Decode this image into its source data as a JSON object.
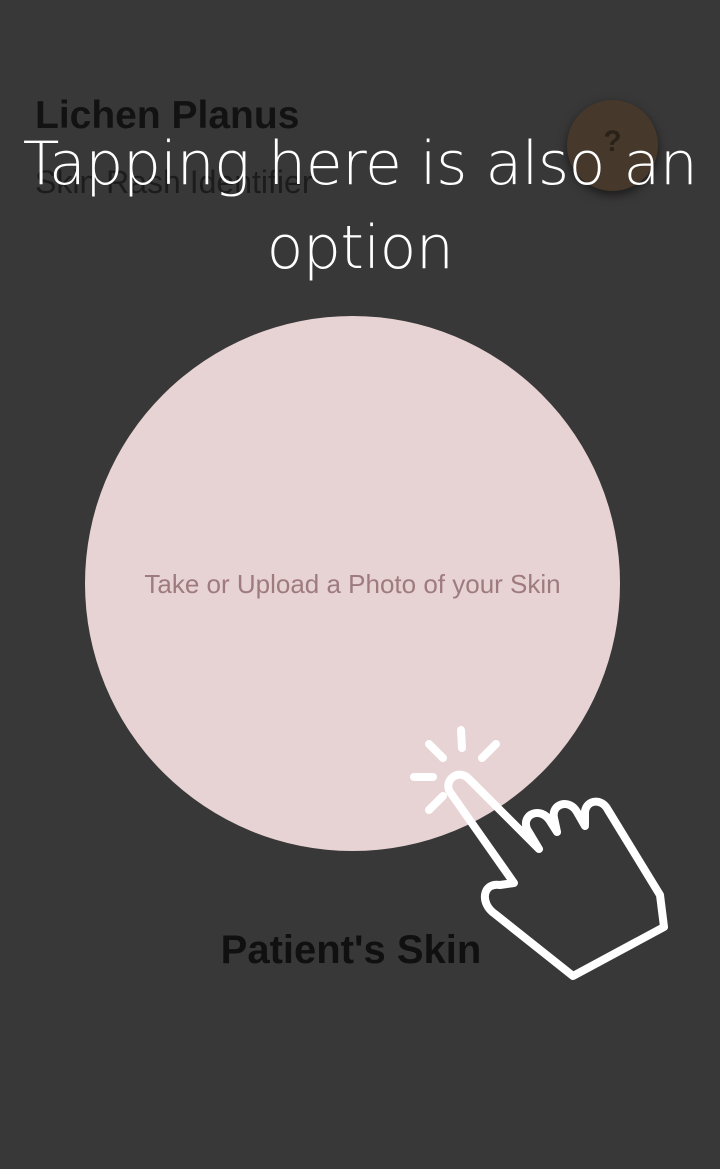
{
  "header": {
    "title": "Lichen Planus",
    "subtitle": "Skin Rash Identifier",
    "help_icon": "question-icon",
    "help_glyph": "?"
  },
  "tutorial": {
    "hint": "Tapping here is also an option",
    "gesture_icon": "tap-hand-icon"
  },
  "upload": {
    "label": "Take or Upload a Photo of your Skin"
  },
  "section": {
    "title": "Patient's Skin"
  },
  "colors": {
    "overlay": "#393838",
    "circle": "#e8d3d4",
    "circle_text": "#9e7b7e",
    "hint_text": "#ffffff"
  }
}
